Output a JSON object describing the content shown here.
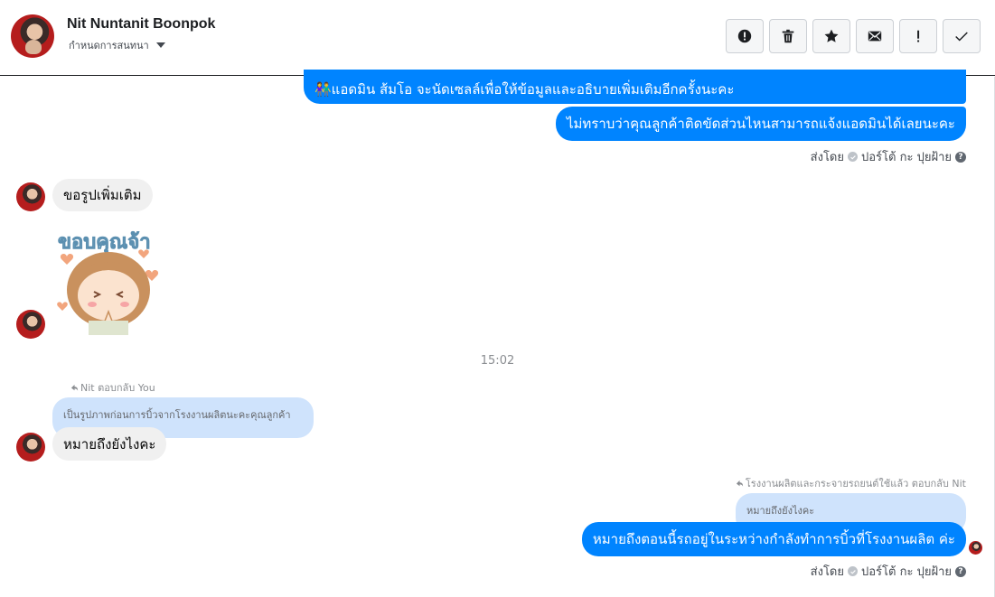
{
  "header": {
    "contact_name": "Nit Nuntanit Boonpok",
    "status_text": "กำหนดการสนทนา",
    "toolbar": [
      {
        "name": "report-button",
        "icon": "alert-circle-icon"
      },
      {
        "name": "delete-button",
        "icon": "trash-icon"
      },
      {
        "name": "star-button",
        "icon": "star-icon"
      },
      {
        "name": "mark-unread-button",
        "icon": "envelope-icon"
      },
      {
        "name": "spam-button",
        "icon": "exclamation-icon"
      },
      {
        "name": "done-button",
        "icon": "checkmark-icon"
      }
    ]
  },
  "messages": {
    "m1": "👫แอดมิน ส้มโอ จะนัดเซลล์เพื่อให้ข้อมูลและอธิบายเพิ่มเติมอีกครั้งนะคะ",
    "m2": "ไม่ทราบว่าคุณลูกค้าติดขัดส่วนไหนสามารถแจ้งแอดมินได้เลยนะคะ",
    "m3": "ขอรูปเพิ่มเติม",
    "sticker_text": "ขอบคุณจ้า",
    "timestamp": "15:02",
    "reply1_label": "Nit ตอบกลับ You",
    "reply1_quote": "เป็นรูปภาพก่อนการบิ้วจากโรงงานผลิตนะคะคุณลูกค้า",
    "m4": "หมายถึงยังไงคะ",
    "reply2_label": "โรงงานผลิตและกระจายรถยนต์ใช้แล้ว ตอบกลับ Nit",
    "reply2_quote": "หมายถึงยังไงคะ",
    "m5": "หมายถึงตอนนี้รถอยู่ในระหว่างกำลังทำการบิ้วที่โรงงานผลิต ค่ะ"
  },
  "sent_by": {
    "prefix": "ส่งโดย",
    "sender": "ปอร์โต้ กะ ปุยฝ้าย",
    "help": "?"
  },
  "colors": {
    "outgoing": "#0084ff",
    "incoming": "#f0f0f0",
    "quote": "#cfe3fc"
  }
}
